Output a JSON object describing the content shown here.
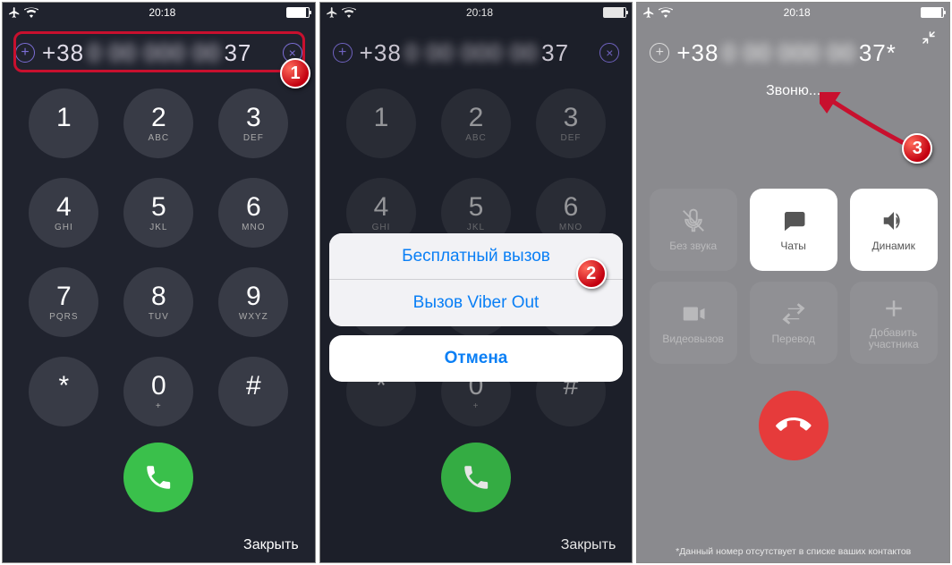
{
  "statusbar": {
    "time": "20:18"
  },
  "number": {
    "prefix": "+38",
    "obscured": "0 00 000 00",
    "suffix": "37",
    "suffix_star": "37*"
  },
  "keypad": [
    {
      "d": "1",
      "l": ""
    },
    {
      "d": "2",
      "l": "ABC"
    },
    {
      "d": "3",
      "l": "DEF"
    },
    {
      "d": "4",
      "l": "GHI"
    },
    {
      "d": "5",
      "l": "JKL"
    },
    {
      "d": "6",
      "l": "MNO"
    },
    {
      "d": "7",
      "l": "PQRS"
    },
    {
      "d": "8",
      "l": "TUV"
    },
    {
      "d": "9",
      "l": "WXYZ"
    },
    {
      "d": "*",
      "l": ""
    },
    {
      "d": "0",
      "l": "+"
    },
    {
      "d": "#",
      "l": ""
    }
  ],
  "close_label": "Закрыть",
  "sheet": {
    "free_call": "Бесплатный вызов",
    "viber_out": "Вызов Viber Out",
    "cancel": "Отмена"
  },
  "call": {
    "status": "Звоню...",
    "mute": "Без звука",
    "chats": "Чаты",
    "speaker": "Динамик",
    "video": "Видеовызов",
    "transfer": "Перевод",
    "add": "Добавить участника"
  },
  "footnote": "*Данный номер отсутствует в списке ваших контактов",
  "bubbles": {
    "one": "1",
    "two": "2",
    "three": "3"
  }
}
